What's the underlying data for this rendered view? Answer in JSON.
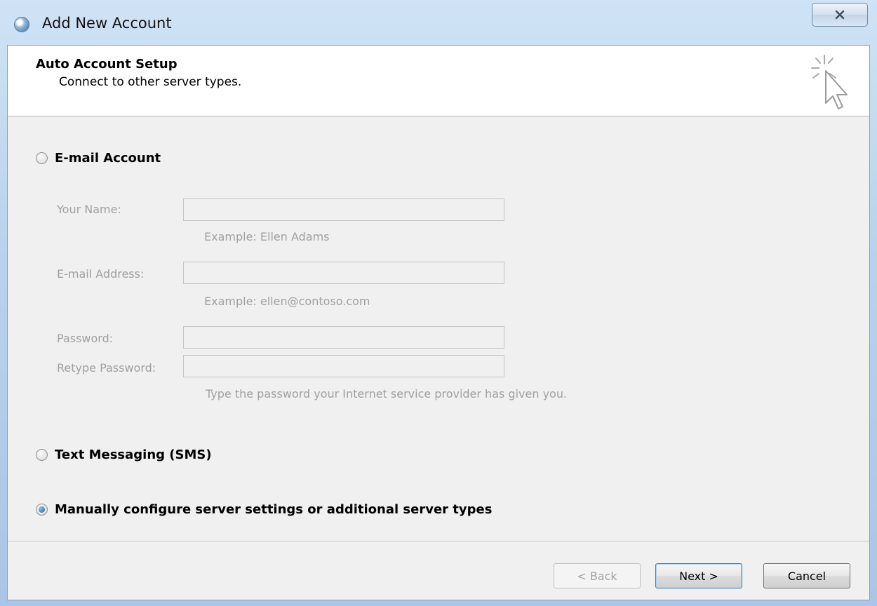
{
  "window": {
    "title": "Add New Account",
    "close_icon": "close-icon"
  },
  "header": {
    "title": "Auto Account Setup",
    "subtitle": "Connect to other server types.",
    "graphic_icon": "sparkle-cursor-icon"
  },
  "options": {
    "email_account": {
      "label": "E-mail Account",
      "selected": false
    },
    "text_messaging": {
      "label": "Text Messaging (SMS)",
      "selected": false
    },
    "manual_config": {
      "label": "Manually configure server settings or additional server types",
      "selected": true
    }
  },
  "form": {
    "your_name": {
      "label": "Your Name:",
      "value": "",
      "hint": "Example: Ellen Adams"
    },
    "email_address": {
      "label": "E-mail Address:",
      "value": "",
      "hint": "Example: ellen@contoso.com"
    },
    "password": {
      "label": "Password:",
      "value": ""
    },
    "retype_password": {
      "label": "Retype Password:",
      "value": ""
    },
    "password_hint": "Type the password your Internet service provider has given you."
  },
  "buttons": {
    "back": "< Back",
    "next": "Next >",
    "cancel": "Cancel"
  },
  "colors": {
    "accent": "#3c7fb1",
    "disabled_text": "#a0a0a0"
  }
}
